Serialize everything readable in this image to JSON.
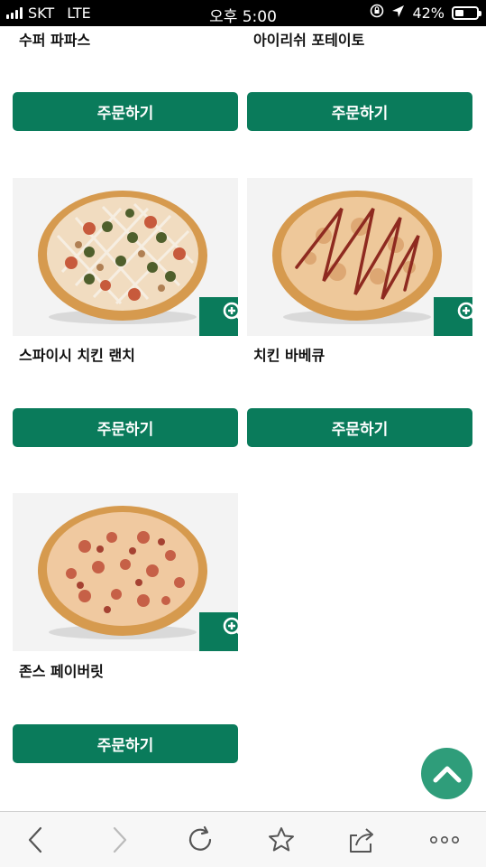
{
  "status_bar": {
    "carrier": "SKT",
    "network": "LTE",
    "time": "오후 5:00",
    "battery_percent": "42%",
    "battery_level": 0.42,
    "icons": [
      "signal-icon",
      "orientation-lock-icon",
      "location-arrow-icon",
      "battery-icon"
    ]
  },
  "products": [
    {
      "name": "수퍼 파파스",
      "order_label": "주문하기",
      "has_image": false
    },
    {
      "name": "아이리쉬 포테이토",
      "order_label": "주문하기",
      "has_image": false
    },
    {
      "name": "스파이시 치킨 랜치",
      "order_label": "주문하기",
      "has_image": true,
      "image": "pizza-spicy-chicken-ranch"
    },
    {
      "name": "치킨 바베큐",
      "order_label": "주문하기",
      "has_image": true,
      "image": "pizza-chicken-bbq"
    },
    {
      "name": "존스 페이버릿",
      "order_label": "주문하기",
      "has_image": true,
      "image": "pizza-johns-favorite"
    }
  ],
  "colors": {
    "brand_green": "#0a7b5b",
    "scroll_top_green": "#2f9d7a",
    "thumb_bg": "#f3f3f3"
  },
  "scroll_top_icon": "chevron-up-icon",
  "toolbar": {
    "icons": [
      "back-icon",
      "forward-icon",
      "reload-icon",
      "bookmark-star-icon",
      "share-icon",
      "more-icon"
    ]
  }
}
